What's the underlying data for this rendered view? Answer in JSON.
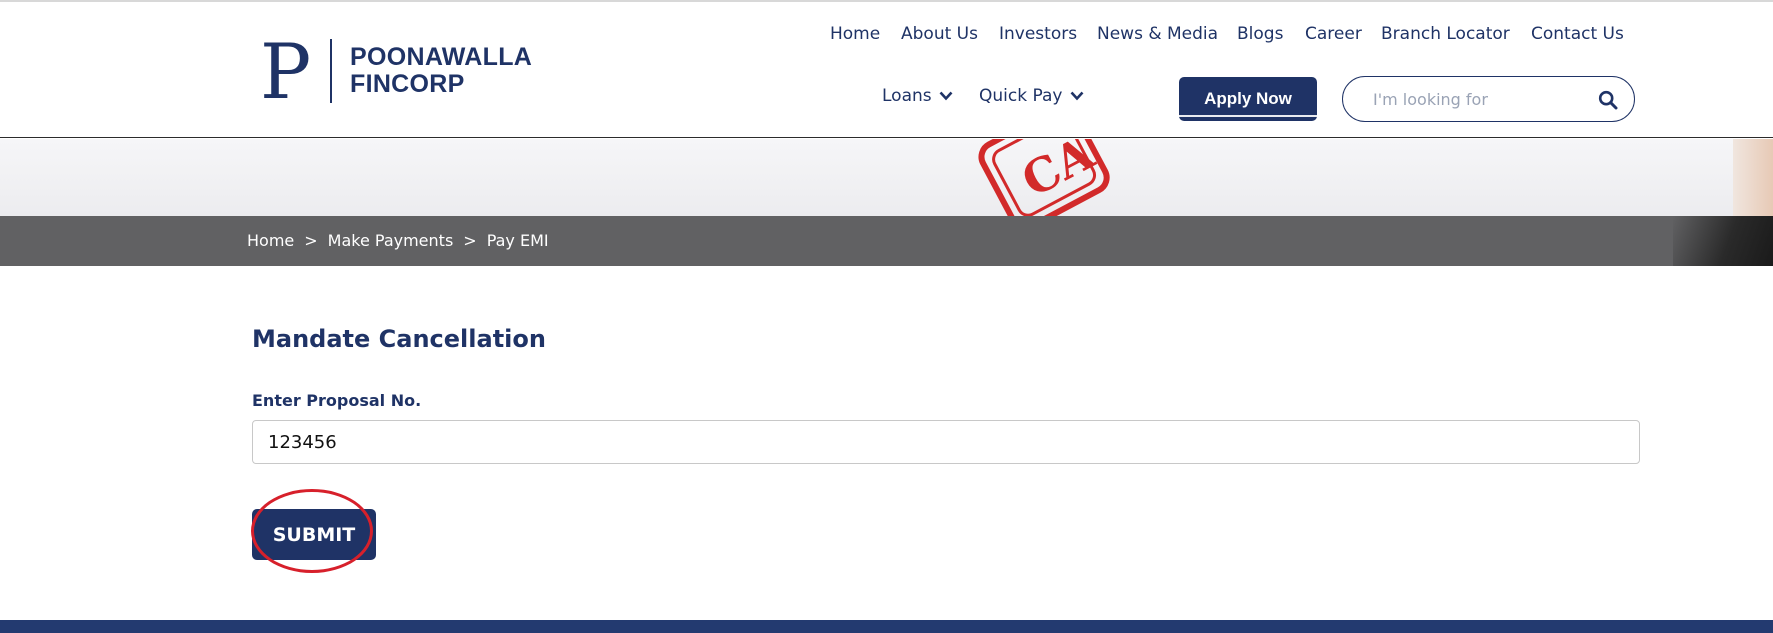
{
  "brand": {
    "logo_letter": "P",
    "line1": "POONAWALLA",
    "line2": "FINCORP",
    "color": "#1f3366"
  },
  "nav": {
    "top_links": [
      "Home",
      "About Us",
      "Investors",
      "News & Media",
      "Blogs",
      "Career",
      "Branch Locator",
      "Contact Us"
    ],
    "loans": "Loans",
    "quick_pay": "Quick Pay",
    "apply_now": "Apply Now"
  },
  "search": {
    "placeholder": "I'm looking for",
    "icon": "search-icon"
  },
  "breadcrumb": {
    "items": [
      "Home",
      "Make Payments",
      "Pay EMI"
    ],
    "separator": ">"
  },
  "form": {
    "title": "Mandate Cancellation",
    "field_label": "Enter Proposal No.",
    "proposal_value": "123456",
    "submit_label": "SUBMIT"
  },
  "colors": {
    "primary": "#1f3366",
    "breadcrumb_bg": "#616163",
    "annotation": "#d7202b"
  }
}
